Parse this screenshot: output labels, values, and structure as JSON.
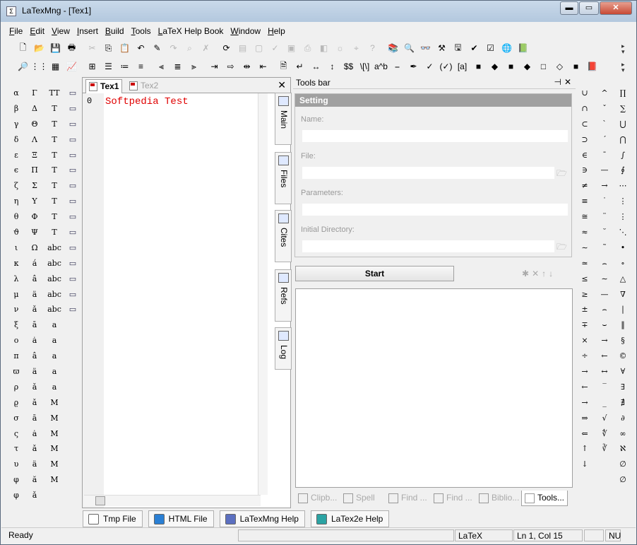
{
  "window": {
    "title": "LaTexMng - [Tex1]",
    "app_icon_glyph": "Σ",
    "controls": {
      "minimize": "▬",
      "maximize": "▭",
      "close": "✕"
    }
  },
  "menu": [
    "File",
    "Edit",
    "View",
    "Insert",
    "Build",
    "Tools",
    "LaTeX Help Book",
    "Window",
    "Help"
  ],
  "toolbar1": [
    {
      "icon": "new-file-icon",
      "glyph": "🗋"
    },
    {
      "icon": "open-folder-icon",
      "glyph": "📂"
    },
    {
      "icon": "save-icon",
      "glyph": "💾"
    },
    {
      "icon": "print-icon",
      "glyph": "🖶"
    },
    {
      "icon": "cut-icon",
      "glyph": "✂",
      "disabled": true
    },
    {
      "icon": "copy-icon",
      "glyph": "⎘"
    },
    {
      "icon": "paste-icon",
      "glyph": "📋"
    },
    {
      "icon": "undo-icon",
      "glyph": "↶"
    },
    {
      "icon": "format-icon",
      "glyph": "✎"
    },
    {
      "icon": "redo-icon",
      "glyph": "↷",
      "disabled": true
    },
    {
      "icon": "find-icon",
      "glyph": "⌕",
      "disabled": true
    },
    {
      "icon": "tools-icon",
      "glyph": "✗",
      "disabled": true
    },
    {
      "icon": "refresh-icon",
      "glyph": "⟳"
    },
    {
      "icon": "compile-icon",
      "glyph": "▤",
      "disabled": true
    },
    {
      "icon": "page-icon",
      "glyph": "▢",
      "disabled": true
    },
    {
      "icon": "edit-page-icon",
      "glyph": "✓",
      "disabled": true
    },
    {
      "icon": "pages-icon",
      "glyph": "▣",
      "disabled": true
    },
    {
      "icon": "dvi-icon",
      "glyph": "⎙",
      "disabled": true
    },
    {
      "icon": "pdf-icon",
      "glyph": "◧",
      "disabled": true
    },
    {
      "icon": "ps-icon",
      "glyph": "☼",
      "disabled": true
    },
    {
      "icon": "view-icon",
      "glyph": "⌖",
      "disabled": true
    },
    {
      "icon": "help-circle-icon",
      "glyph": "?",
      "disabled": true
    },
    {
      "icon": "books-icon",
      "glyph": "📚"
    },
    {
      "icon": "search-doc-icon",
      "glyph": "🔍"
    },
    {
      "icon": "binoculars-icon",
      "glyph": "👓"
    },
    {
      "icon": "hammer-icon",
      "glyph": "⚒"
    },
    {
      "icon": "save-red-icon",
      "glyph": "🖫"
    },
    {
      "icon": "spell-icon",
      "glyph": "✔"
    },
    {
      "icon": "checkbox-icon",
      "glyph": "☑"
    },
    {
      "icon": "globe-icon",
      "glyph": "🌐"
    },
    {
      "icon": "book-icon",
      "glyph": "📗"
    }
  ],
  "toolbar2": [
    {
      "icon": "zoom-icon",
      "glyph": "🔎"
    },
    {
      "icon": "grid-icon",
      "glyph": "⋮⋮"
    },
    {
      "icon": "table-icon",
      "glyph": "▦"
    },
    {
      "icon": "chart-icon",
      "glyph": "📈"
    },
    {
      "icon": "matrix-icon",
      "glyph": "⊞"
    },
    {
      "icon": "bullets-icon",
      "glyph": "☰"
    },
    {
      "icon": "numbering-icon",
      "glyph": "≔"
    },
    {
      "icon": "description-icon",
      "glyph": "≡"
    },
    {
      "icon": "align-left-icon",
      "glyph": "⫷"
    },
    {
      "icon": "align-center-icon",
      "glyph": "≣"
    },
    {
      "icon": "align-right-icon",
      "glyph": "⫸"
    },
    {
      "icon": "indent-icon",
      "glyph": "⇥"
    },
    {
      "icon": "arrow-right-bar-icon",
      "glyph": "⇨"
    },
    {
      "icon": "arrow-split-icon",
      "glyph": "⇹"
    },
    {
      "icon": "arrow-left-bar-icon",
      "glyph": "⇤"
    },
    {
      "icon": "page-break-icon",
      "glyph": "🗎"
    },
    {
      "icon": "line-break-icon",
      "glyph": "↵"
    },
    {
      "icon": "hspace-icon",
      "glyph": "↔"
    },
    {
      "icon": "vspace-icon",
      "glyph": "↕"
    },
    {
      "icon": "math-icon",
      "glyph": "$$"
    },
    {
      "icon": "display-math-icon",
      "glyph": "\\[\\]"
    },
    {
      "icon": "superscript-icon",
      "glyph": "a^b"
    },
    {
      "icon": "underline-icon",
      "glyph": "⎯"
    },
    {
      "icon": "pen-icon",
      "glyph": "✒"
    },
    {
      "icon": "check-green-icon",
      "glyph": "✓"
    },
    {
      "icon": "check-paren-icon",
      "glyph": "(✓)"
    },
    {
      "icon": "bracket-a-icon",
      "glyph": "[a]"
    },
    {
      "icon": "square-blue-icon",
      "glyph": "■"
    },
    {
      "icon": "diamond-blue-icon",
      "glyph": "◆"
    },
    {
      "icon": "small-square-icon",
      "glyph": "■"
    },
    {
      "icon": "diamond-light-icon",
      "glyph": "◆"
    },
    {
      "icon": "cyan-square-icon",
      "glyph": "□"
    },
    {
      "icon": "cyan-diamond-icon",
      "glyph": "◇"
    },
    {
      "icon": "magenta-square-icon",
      "glyph": "■"
    },
    {
      "icon": "book-red-icon",
      "glyph": "📕"
    }
  ],
  "symbols_col1": [
    "α",
    "β",
    "γ",
    "δ",
    "ε",
    "ϵ",
    "ζ",
    "η",
    "θ",
    "ϑ",
    "ι",
    "κ",
    "λ",
    "μ",
    "ν",
    "ξ",
    "o",
    "π",
    "ϖ",
    "ρ",
    "ϱ",
    "σ",
    "ς",
    "τ",
    "υ",
    "φ",
    "φ"
  ],
  "symbols_col2": [
    "Γ",
    "Δ",
    "Θ",
    "Λ",
    "Ξ",
    "Π",
    "Σ",
    "Υ",
    "Φ",
    "Ψ",
    "Ω",
    "á",
    "â",
    "ä",
    "ǎ",
    "ā",
    "ȧ",
    "â",
    "ä",
    "ǎ",
    "ǎ",
    "ā",
    "ȧ",
    "ǎ",
    "ä",
    "ă",
    "ǎ"
  ],
  "symbols_col3": [
    "TT",
    "T",
    "T",
    "T",
    "T",
    "T",
    "T",
    "T",
    "T",
    "T",
    "abc",
    "abc",
    "abc",
    "abc",
    "abc",
    "a",
    "a",
    "a",
    "a",
    "a",
    "M",
    "M",
    "M",
    "M",
    "M",
    "M"
  ],
  "symbols_col5": [
    "∪",
    "∩",
    "⊂",
    "⊃",
    "∈",
    "∋",
    "≠",
    "≡",
    "≅",
    "≈",
    "∼",
    "≃",
    "≤",
    "≥",
    "±",
    "∓",
    "×",
    "÷",
    "→",
    "←",
    "→",
    "⇒",
    "⇐",
    "↑",
    "↓"
  ],
  "symbols_col6": [
    "^",
    "ˇ",
    "`",
    "´",
    "¯",
    "—",
    "→",
    "˙",
    "¨",
    "˘",
    "˜",
    "⌢",
    "∼",
    "—",
    "⌢",
    "⌣",
    "→",
    "←",
    "↔",
    "‾",
    "_",
    "√",
    "∜",
    "∛"
  ],
  "symbols_col7": [
    "∏",
    "∑",
    "⋃",
    "⋂",
    "∫",
    "∮",
    "⋯",
    "⋮",
    "⋮",
    "⋱",
    "•",
    "∘",
    "△",
    "∇",
    "|",
    "‖",
    "§",
    "©",
    "∀",
    "∃",
    "∄",
    "∂",
    "∞",
    "ℵ",
    "∅",
    "∅"
  ],
  "editor": {
    "tabs": [
      "Tex1",
      "Tex2"
    ],
    "close": "✕",
    "line_number": "0",
    "code_line": "Softpedia Test"
  },
  "side_tabs": [
    "Main",
    "Files",
    "Cites",
    "Refs",
    "Log"
  ],
  "tools_bar": {
    "title": "Tools bar",
    "pin": "⊣",
    "close": "✕",
    "setting_header": "Setting",
    "fields": [
      {
        "label": "Name:",
        "value": "",
        "browse": false
      },
      {
        "label": "File:",
        "value": "",
        "browse": true
      },
      {
        "label": "Parameters:",
        "value": "",
        "browse": false
      },
      {
        "label": "Initial Directory:",
        "value": "",
        "browse": true
      }
    ],
    "start_label": "Start",
    "mini_tools": [
      "✱",
      "✕",
      "↑",
      "↓"
    ],
    "bottom_tabs": [
      {
        "label": "Clipb...",
        "icon": "clipboard-icon",
        "active": false
      },
      {
        "label": "Spell",
        "icon": "spell-check-icon",
        "active": false
      },
      {
        "label": "Find ...",
        "icon": "find-files-icon",
        "active": false
      },
      {
        "label": "Find ...",
        "icon": "find-replace-icon",
        "active": false
      },
      {
        "label": "Biblio...",
        "icon": "bibliography-icon",
        "active": false
      },
      {
        "label": "Tools...",
        "icon": "hammer-tools-icon",
        "active": true
      }
    ]
  },
  "file_tabs": [
    {
      "label": "Tmp File",
      "icon": "tmp-file-icon",
      "color": "#ffffff"
    },
    {
      "label": "HTML File",
      "icon": "globe-file-icon",
      "color": "#2a7fd4"
    },
    {
      "label": "LaTexMng Help",
      "icon": "help-book-icon",
      "color": "#5b6fc0"
    },
    {
      "label": "LaTex2e Help",
      "icon": "latex-book-icon",
      "color": "#2ba3a3"
    }
  ],
  "status": {
    "message": "Ready",
    "mode": "LaTeX",
    "position": "Ln 1, Col 15",
    "caps": "",
    "num": "NU"
  },
  "colors": {
    "code_text": "#e00000",
    "title_bar": "#c9d9ea",
    "setting_header": "#a0a0a0"
  }
}
